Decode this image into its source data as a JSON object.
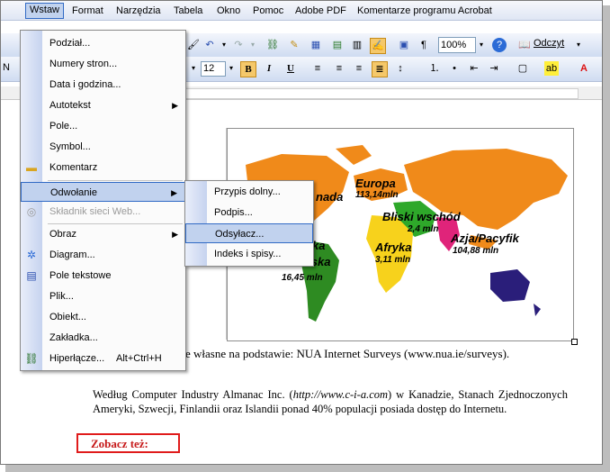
{
  "menubar": {
    "items": [
      {
        "label": "Wstaw",
        "active": true
      },
      {
        "label": "Format"
      },
      {
        "label": "Narzędzia"
      },
      {
        "label": "Tabela"
      },
      {
        "label": "Okno"
      },
      {
        "label": "Pomoc"
      },
      {
        "label": "Adobe PDF"
      },
      {
        "label": "Komentarze programu Acrobat"
      }
    ]
  },
  "toolbar": {
    "zoom": "100%",
    "reading_label": "Odczyt",
    "font_size": "12",
    "font_name_partial": "N",
    "bold": "B",
    "italic": "I",
    "underline": "U"
  },
  "insert_menu": {
    "items": [
      {
        "label": "Podział..."
      },
      {
        "label": "Numery stron..."
      },
      {
        "label": "Data i godzina..."
      },
      {
        "label": "Autotekst",
        "submenu": true
      },
      {
        "label": "Pole..."
      },
      {
        "label": "Symbol..."
      },
      {
        "label": "Komentarz",
        "icon": "comment-icon"
      },
      {
        "label": "Odwołanie",
        "submenu": true,
        "highlighted": true
      },
      {
        "label": "Składnik sieci Web...",
        "disabled": true,
        "icon": "web-component-icon"
      },
      {
        "label": "Obraz",
        "submenu": true
      },
      {
        "label": "Diagram...",
        "icon": "diagram-icon"
      },
      {
        "label": "Pole tekstowe",
        "icon": "textbox-icon"
      },
      {
        "label": "Plik..."
      },
      {
        "label": "Obiekt..."
      },
      {
        "label": "Zakładka..."
      },
      {
        "label": "Hiperłącze...",
        "shortcut": "Alt+Ctrl+H",
        "icon": "hyperlink-icon"
      }
    ]
  },
  "reference_submenu": {
    "items": [
      {
        "label": "Przypis dolny..."
      },
      {
        "label": "Podpis..."
      },
      {
        "label": "Odsyłacz...",
        "highlighted": true
      },
      {
        "label": "Indeks i spisy..."
      }
    ]
  },
  "map": {
    "labels": [
      {
        "text": "Europa"
      },
      {
        "text": "113,14mln"
      },
      {
        "text": "nada"
      },
      {
        "text": "Bliski wschód"
      },
      {
        "text": "2,4 mln"
      },
      {
        "text": "Azja/Pacyfik"
      },
      {
        "text": "104,88 mln"
      },
      {
        "text": "Afryka"
      },
      {
        "text": "3,11 mln"
      },
      {
        "text": "ka"
      },
      {
        "text": "cińska"
      },
      {
        "text": "16,45 mln"
      }
    ]
  },
  "document": {
    "caption": "e własne na podstawie: NUA Internet Surveys (www.nua.ie/surveys).",
    "paragraph_part1": "Według Computer Industry Almanac Inc. (",
    "paragraph_link": "http://www.c-i-a.com",
    "paragraph_part2": ") w Kanadzie, Stanach Zjednoczonych Ameryki, Szwecji, Finlandii oraz Islandii ponad 40% populacji posiada dostęp do Internetu.",
    "see_also": "Zobacz też:"
  },
  "colors": {
    "menu_highlight": "#c1d2ee",
    "menu_highlight_border": "#316ac5",
    "see_also_border": "#e01b1b",
    "north_america": "#f08a1a",
    "south_america": "#2e8b22",
    "europe": "#f08a1a",
    "africa": "#f7d21c",
    "middle_east": "#2ea82a",
    "asia": "#f08a1a",
    "russia": "#f08a1a",
    "australia": "#2a1e7a",
    "south_asia": "#e0247a"
  }
}
